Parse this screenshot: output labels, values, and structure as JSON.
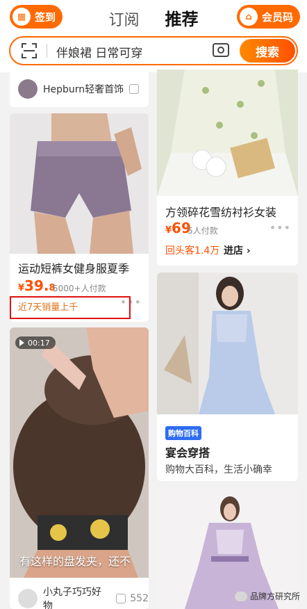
{
  "header": {
    "checkin_label": "签到",
    "tab_follow": "订阅",
    "tab_recommend": "推荐",
    "member_label": "会员码"
  },
  "search": {
    "placeholder": "伴娘裙 日常可穿",
    "button": "搜索"
  },
  "cards": {
    "hepburn": {
      "store": "Hepburn轻奢首饰"
    },
    "shorts": {
      "title": "运动短裤女健身服夏季",
      "price_symbol": "¥",
      "price_int": "39.",
      "price_dec": "8",
      "paid": "5000+人付款",
      "note": "近7天销量上千"
    },
    "video": {
      "duration": "00:17",
      "overlay": "有这样的盘发夹，还不",
      "store": "小丸子巧巧好物",
      "likes": "552"
    },
    "shirt": {
      "title": "方领碎花雪纺衬衫女装",
      "price_symbol": "¥",
      "price": "69",
      "paid": "5人付款",
      "repeat": "回头客1.4万",
      "enter": "进店 ›"
    },
    "banquet": {
      "badge": "购物百科",
      "title": "宴会穿搭",
      "sub": "购物大百科，生活小确幸"
    }
  },
  "watermark": "品牌方研究所",
  "colors": {
    "accent": "#ff6a00",
    "price": "#ff5000",
    "highlight": "#e01010"
  }
}
